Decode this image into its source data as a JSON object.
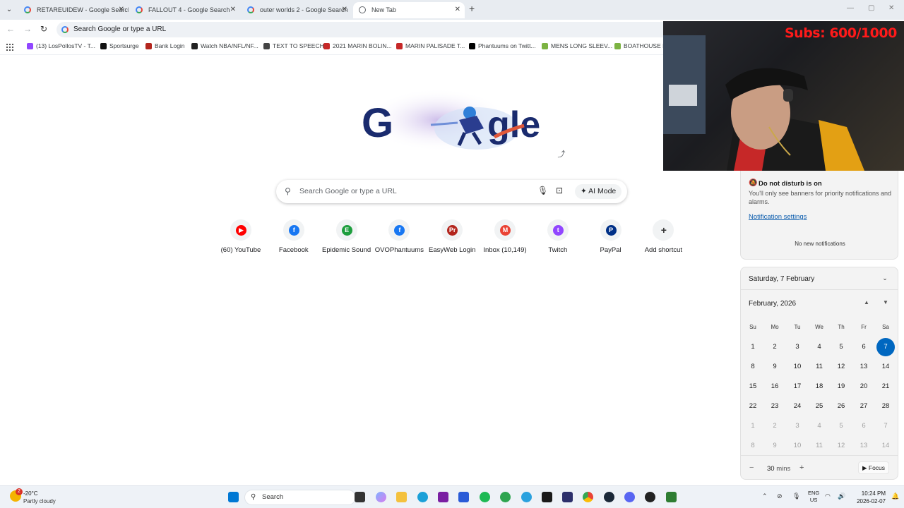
{
  "tabs": [
    {
      "title": "RETAREUIDEW - Google Search",
      "icon": "google-icon"
    },
    {
      "title": "FALLOUT 4 - Google Search",
      "icon": "google-icon"
    },
    {
      "title": "outer worlds 2 - Google Search",
      "icon": "google-icon"
    },
    {
      "title": "New Tab",
      "icon": "globe-icon",
      "active": true
    }
  ],
  "omnibox": {
    "text": "Search Google or type a URL"
  },
  "bookmarks": [
    {
      "label": "(13) LosPollosTV - T...",
      "color": "#9146ff"
    },
    {
      "label": "Sportsurge",
      "color": "#111111"
    },
    {
      "label": "Bank Login",
      "color": "#b3261e"
    },
    {
      "label": "Watch NBA/NFL/NF...",
      "color": "#222222"
    },
    {
      "label": "TEXT TO SPEECH",
      "color": "#444444"
    },
    {
      "label": "2021 MARIN BOLIN...",
      "color": "#c62828"
    },
    {
      "label": "MARIN PALISADE T...",
      "color": "#c62828"
    },
    {
      "label": "Phantuums on Twitt...",
      "color": "#000000"
    },
    {
      "label": "MENS LONG SLEEV...",
      "color": "#7cb342"
    },
    {
      "label": "BOATHOUSE LO...",
      "color": "#7cb342"
    }
  ],
  "search": {
    "placeholder": "Search Google or type a URL",
    "ai_mode": "AI Mode"
  },
  "shortcuts": [
    {
      "label": "(60) YouTube",
      "color": "#ff0000",
      "glyph": "▶"
    },
    {
      "label": "Facebook",
      "color": "#1877f2",
      "glyph": "f"
    },
    {
      "label": "Epidemic Sound",
      "color": "#1e9e3e",
      "glyph": "E"
    },
    {
      "label": "OVOPhantuums",
      "color": "#1877f2",
      "glyph": "f"
    },
    {
      "label": "EasyWeb Login",
      "color": "#b3261e",
      "glyph": "Pr"
    },
    {
      "label": "Inbox (10,149)",
      "color": "#ea4335",
      "glyph": "M"
    },
    {
      "label": "Twitch",
      "color": "#9146ff",
      "glyph": "t"
    },
    {
      "label": "PayPal",
      "color": "#003087",
      "glyph": "P"
    },
    {
      "label": "Add shortcut",
      "color": "#f1f3f4",
      "glyph": "+"
    }
  ],
  "webcam": {
    "overlay": "Subs: 600/1000"
  },
  "notifications": {
    "dnd_title": "Do not disturb is on",
    "dnd_desc": "You'll only see banners for priority notifications and alarms.",
    "settings_link": "Notification settings",
    "empty": "No new notifications"
  },
  "calendar": {
    "date_header": "Saturday, 7 February",
    "month": "February, 2026",
    "weekdays": [
      "Su",
      "Mo",
      "Tu",
      "We",
      "Th",
      "Fr",
      "Sa"
    ],
    "weeks": [
      [
        "1",
        "2",
        "3",
        "4",
        "5",
        "6",
        "7"
      ],
      [
        "8",
        "9",
        "10",
        "11",
        "12",
        "13",
        "14"
      ],
      [
        "15",
        "16",
        "17",
        "18",
        "19",
        "20",
        "21"
      ],
      [
        "22",
        "23",
        "24",
        "25",
        "26",
        "27",
        "28"
      ],
      [
        "1",
        "2",
        "3",
        "4",
        "5",
        "6",
        "7"
      ],
      [
        "8",
        "9",
        "10",
        "11",
        "12",
        "13",
        "14"
      ]
    ],
    "selected": "7",
    "focus_value": "30",
    "focus_unit": "mins",
    "focus_label": "Focus"
  },
  "taskbar": {
    "weather_temp": "-20°C",
    "weather_cond": "Partly cloudy",
    "weather_badge": "2",
    "search_label": "Search",
    "lang_line1": "ENG",
    "lang_line2": "US",
    "time": "10:24 PM",
    "date": "2026-02-07"
  }
}
